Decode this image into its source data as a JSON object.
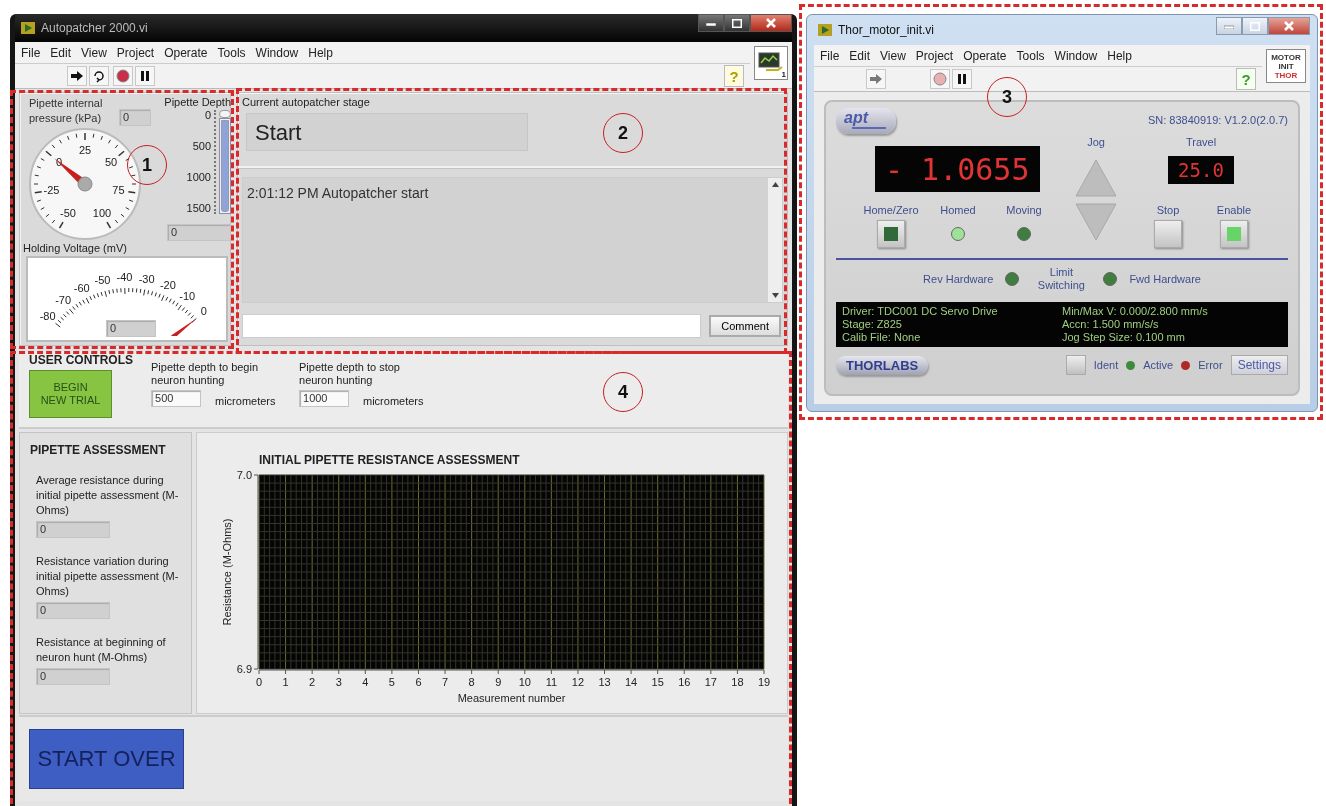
{
  "main_window": {
    "title": "Autopatcher 2000.vi",
    "menu": [
      "File",
      "Edit",
      "View",
      "Project",
      "Operate",
      "Tools",
      "Window",
      "Help"
    ],
    "help_label": "?",
    "vi_icon_number": "1",
    "pressure": {
      "label": "Pipette internal pressure (kPa)",
      "value": "0",
      "scale": [
        "-50",
        "-25",
        "0",
        "25",
        "50",
        "75",
        "100"
      ],
      "level": 0.333
    },
    "depth": {
      "label": "Pipette Depth",
      "scale": [
        "0",
        "500",
        "1000",
        "1500"
      ],
      "value": "0",
      "level": 1
    },
    "holding_voltage": {
      "label": "Holding Voltage (mV)",
      "scale": [
        "-80",
        "-70",
        "-60",
        "-50",
        "-40",
        "-30",
        "-20",
        "-10",
        "0"
      ],
      "value": "0",
      "level": 1
    },
    "stage": {
      "label": "Current autopatcher stage",
      "value": "Start"
    },
    "log": [
      "2:01:12 PM Autopatcher start"
    ],
    "comment_button": "Comment",
    "user_controls": {
      "title": "USER CONTROLS",
      "begin_button": "BEGIN NEW TRIAL",
      "depths": [
        {
          "label": "Pipette depth to begin neuron hunting",
          "value": "500",
          "unit": "micrometers"
        },
        {
          "label": "Pipette depth to stop neuron hunting",
          "value": "1000",
          "unit": "micrometers"
        }
      ]
    },
    "assessment": {
      "title": "PIPETTE ASSESSMENT",
      "fields": [
        {
          "label": "Average resistance during initial pipette assessment (M-Ohms)",
          "value": "0"
        },
        {
          "label": "Resistance variation during initial pipette assessment (M-Ohms)",
          "value": "0"
        },
        {
          "label": "Resistance at beginning of neuron hunt (M-Ohms)",
          "value": "0"
        }
      ]
    },
    "chart_data": {
      "type": "line",
      "grid": true,
      "title": "INITIAL PIPETTE RESISTANCE ASSESSMENT",
      "xlabel": "Measurement number",
      "ylabel": "Resistance (M-Ohms)",
      "xlim": [
        0,
        19
      ],
      "ylim": [
        6.9,
        7.0
      ],
      "xticks": [
        0,
        1,
        2,
        3,
        4,
        5,
        6,
        7,
        8,
        9,
        10,
        11,
        12,
        13,
        14,
        15,
        16,
        17,
        18,
        19
      ],
      "yticks": [
        {
          "value": 6.9,
          "label": "6.9"
        },
        {
          "value": 7.0,
          "label": "7.0"
        }
      ]
    },
    "start_over_button": "START OVER"
  },
  "motor_window": {
    "title": "Thor_motor_init.vi",
    "menu": [
      "File",
      "Edit",
      "View",
      "Project",
      "Operate",
      "Tools",
      "Window",
      "Help"
    ],
    "help_label": "?",
    "vi_icon_lines": [
      "MOTOR",
      "INIT",
      "THOR"
    ],
    "logo": "apt",
    "serial": "SN: 83840919: V1.2.0(2.0.7)",
    "position": "- 1.0655",
    "jog_label": "Jog",
    "travel_label": "Travel",
    "travel": "25.0",
    "controls": [
      {
        "label": "Home/Zero",
        "kind": "button",
        "on": false
      },
      {
        "label": "Homed",
        "kind": "led",
        "on": true
      },
      {
        "label": "Moving",
        "kind": "led",
        "on": false
      },
      {
        "label": "Stop",
        "kind": "plain"
      },
      {
        "label": "Enable",
        "kind": "button",
        "on": true
      }
    ],
    "limits": {
      "label": "Limit Switching",
      "switches": [
        {
          "label": "Rev Hardware",
          "on": false
        },
        {
          "label": "Fwd Hardware",
          "on": false
        }
      ]
    },
    "info_left": [
      "Driver: TDC001 DC Servo Drive",
      "Stage: Z825",
      "Calib File: None"
    ],
    "info_right": [
      "Min/Max V: 0.000/2.800 mm/s",
      "Accn: 1.500 mm/s/s",
      "Jog Step Size: 0.100 mm"
    ],
    "brand": "THORLABS",
    "ident_label": "Ident",
    "status": [
      {
        "label": "Active",
        "color": "#3d8a3d"
      },
      {
        "label": "Error",
        "color": "#b02828"
      }
    ],
    "settings_button": "Settings"
  },
  "callouts": [
    {
      "number": "1"
    },
    {
      "number": "2"
    },
    {
      "number": "3"
    },
    {
      "number": "4"
    }
  ]
}
